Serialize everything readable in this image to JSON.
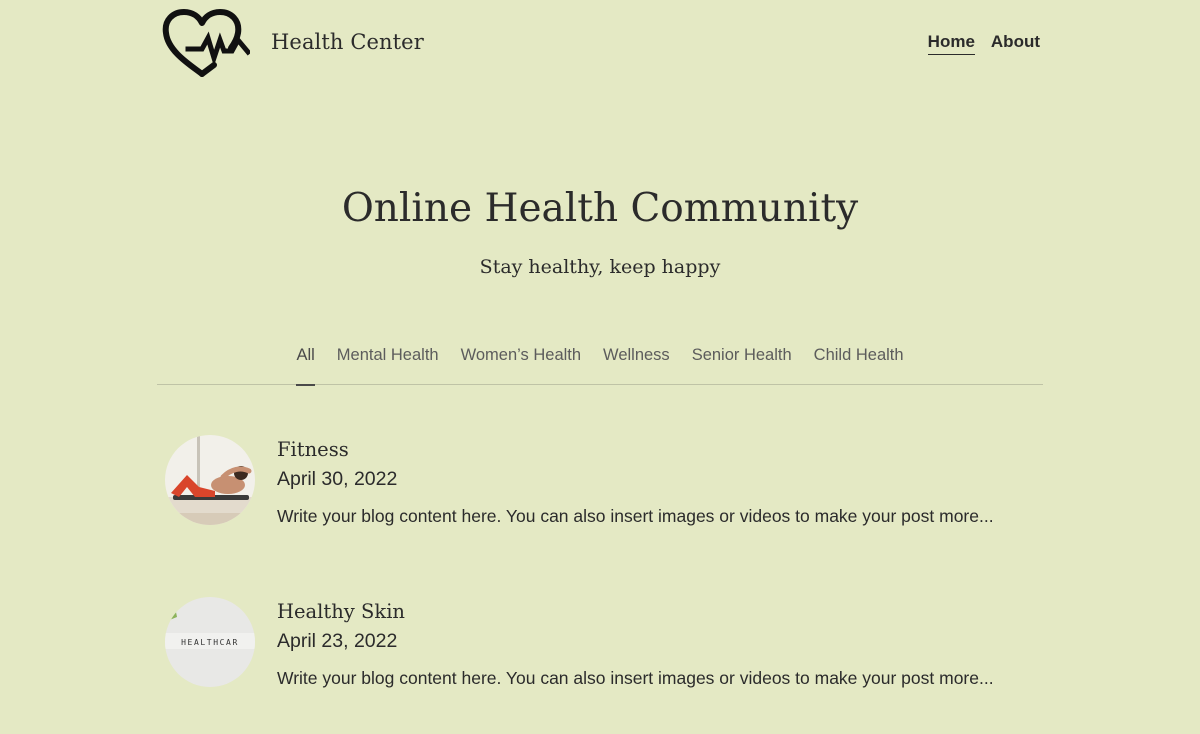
{
  "header": {
    "brand": "Health Center",
    "logo_icon": "heart-pulse-icon",
    "nav": [
      {
        "label": "Home",
        "active": true
      },
      {
        "label": "About",
        "active": false
      }
    ]
  },
  "hero": {
    "title": "Online Health Community",
    "subtitle": "Stay healthy, keep happy"
  },
  "categories": [
    {
      "label": "All",
      "active": true
    },
    {
      "label": "Mental Health",
      "active": false
    },
    {
      "label": "Women’s Health",
      "active": false
    },
    {
      "label": "Wellness",
      "active": false
    },
    {
      "label": "Senior Health",
      "active": false
    },
    {
      "label": "Child Health",
      "active": false
    }
  ],
  "posts": [
    {
      "title": "Fitness",
      "date": "April 30, 2022",
      "excerpt": "Write your blog content here. You can also insert images or videos to make your post more...",
      "thumbnail": "fitness-thumbnail"
    },
    {
      "title": "Healthy Skin",
      "date": "April 23, 2022",
      "excerpt": "Write your blog content here. You can also insert images or videos to make your post more...",
      "thumbnail": "healthcare-thumbnail",
      "thumbnail_text": "HEALTHCAR"
    }
  ],
  "colors": {
    "background": "#e4e9c4",
    "text": "#2b2b2b",
    "muted_text": "#5c5c5c",
    "divider": "#bfc3a6"
  }
}
